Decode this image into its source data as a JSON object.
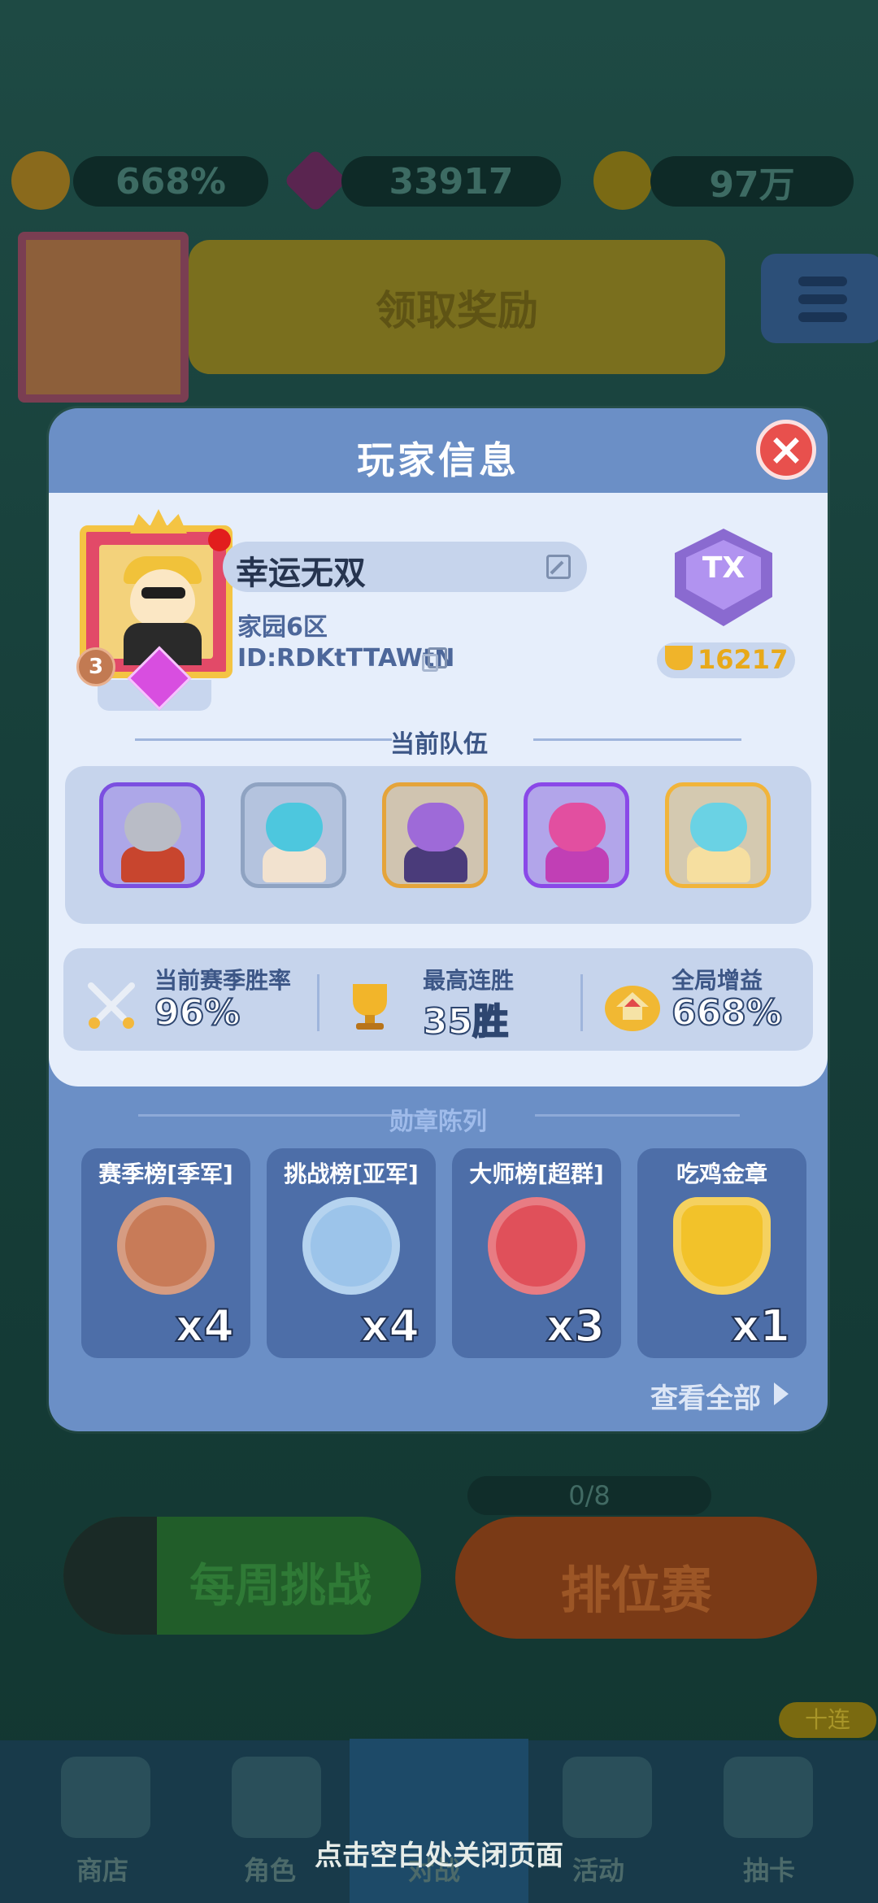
{
  "background": {
    "resources": [
      {
        "icon": "house-boost-icon",
        "value": "668%"
      },
      {
        "icon": "purple-gem-icon",
        "value": "33917"
      },
      {
        "icon": "gold-coin-icon",
        "value": "97万"
      }
    ],
    "claim_button": "领取奖励",
    "weekly_button": "每周挑战",
    "ranked_button": "排位赛",
    "progress": "0/8",
    "ten_pull_badge": "十连",
    "nav": [
      {
        "label": "商店",
        "icon": "shop-icon"
      },
      {
        "label": "角色",
        "icon": "characters-icon"
      },
      {
        "label": "对战",
        "icon": "battle-icon"
      },
      {
        "label": "活动",
        "icon": "events-icon"
      },
      {
        "label": "抽卡",
        "icon": "gacha-icon"
      }
    ]
  },
  "modal": {
    "title": "玩家信息",
    "player": {
      "name": "幸运无双",
      "server": "家园6区",
      "id": "ID:RDKtTTAWtN",
      "level": "3",
      "rank_emblem": "TX",
      "trophies": "16217"
    },
    "team": {
      "title": "当前队伍",
      "heroes": [
        {
          "name": "knight",
          "frame": "#7b4fe0",
          "head": "#b9bcc6",
          "body": "#c8452e"
        },
        {
          "name": "ice-mage",
          "frame": "#8fa3c2",
          "head": "#4dc7de",
          "body": "#f2e2cf"
        },
        {
          "name": "shadow-beast",
          "frame": "#e5a43a",
          "head": "#9e6ad8",
          "body": "#4a3b7a"
        },
        {
          "name": "pink-brute",
          "frame": "#8a48e8",
          "head": "#e24fa0",
          "body": "#c13fb5"
        },
        {
          "name": "crystal-sage",
          "frame": "#f1b43a",
          "head": "#6ad2e4",
          "body": "#f6dfa0"
        }
      ]
    },
    "stats": [
      {
        "icon": "crossed-swords-icon",
        "label": "当前赛季胜率",
        "value": "96%"
      },
      {
        "icon": "trophy-icon",
        "label": "最高连胜",
        "value": "35胜"
      },
      {
        "icon": "house-boost-icon",
        "label": "全局增益",
        "value": "668%"
      }
    ],
    "medals_title": "勋章陈列",
    "medals": [
      {
        "name": "赛季榜[季军]",
        "count": "x4",
        "icon": "bronze-3-medal-icon",
        "color": "#c87b58"
      },
      {
        "name": "挑战榜[亚军]",
        "count": "x4",
        "icon": "silver-2-star-icon",
        "color": "#9cc4ea"
      },
      {
        "name": "大师榜[超群]",
        "count": "x3",
        "icon": "top-10-shield-icon",
        "color": "#e0505a"
      },
      {
        "name": "吃鸡金章",
        "count": "x1",
        "icon": "gold-shield-icon",
        "color": "#f2c22a"
      }
    ],
    "view_all": "查看全部"
  },
  "close_hint": "点击空白处关闭页面"
}
